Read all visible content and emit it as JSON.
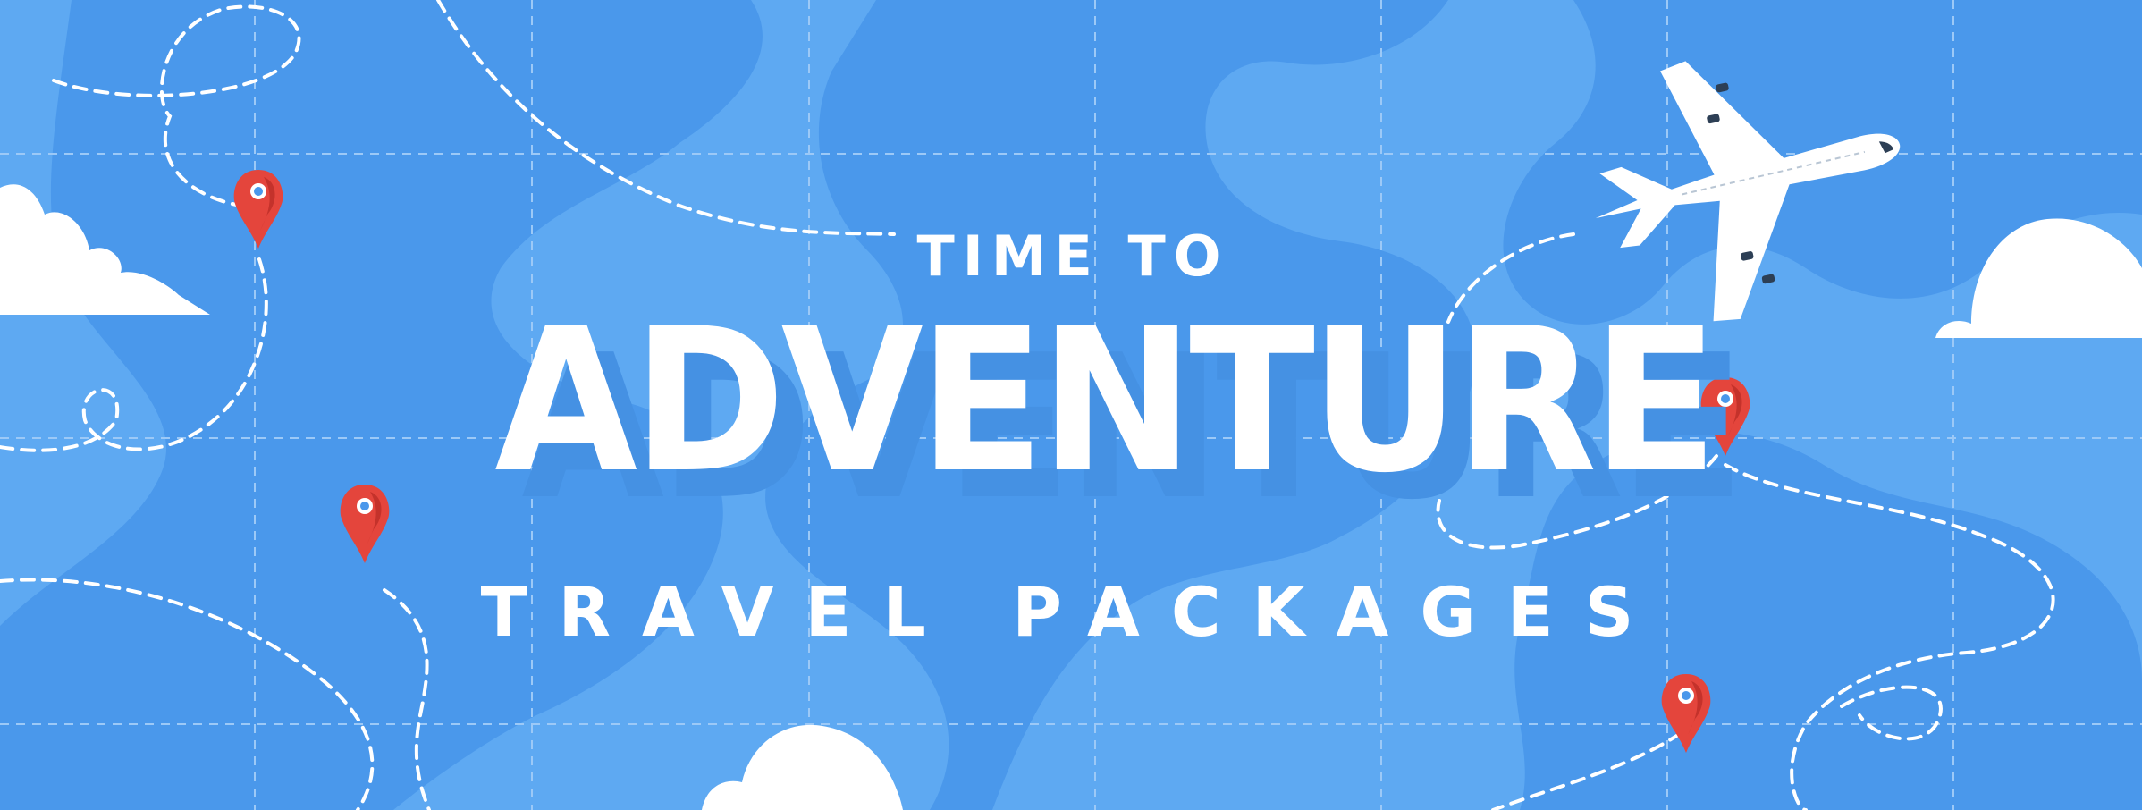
{
  "banner": {
    "kicker": "TIME TO",
    "headline": "ADVENTURE",
    "subline": "TRAVEL PACKAGES"
  },
  "colors": {
    "background": "#5ea9f2",
    "land": "#4a98eb",
    "text": "#ffffff",
    "pin": "#e4453c",
    "plane_windows": "#2d3f55"
  },
  "icons": [
    "map-pin-icon",
    "airplane-icon",
    "cloud-icon"
  ]
}
